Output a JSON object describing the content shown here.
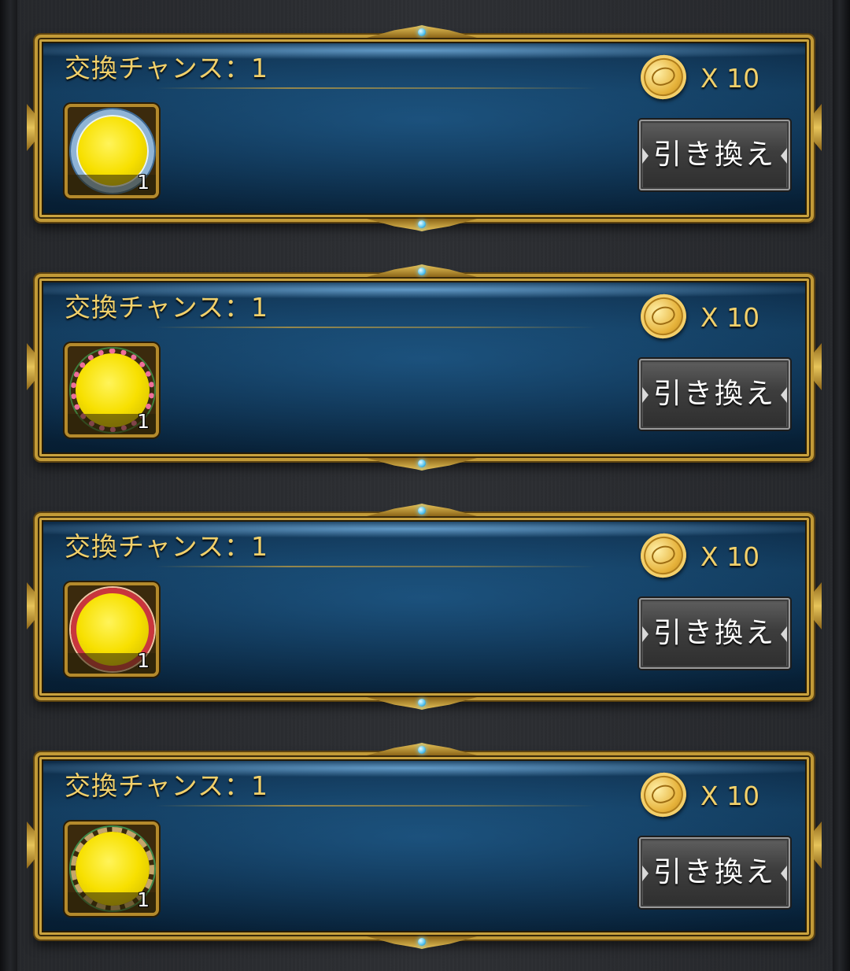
{
  "exchange_items": [
    {
      "title": "交換チャンス：1",
      "item_icon": "ice-frame-icon",
      "item_count": "1",
      "cost_icon": "gold-coin-icon",
      "cost": "X 10",
      "button_label": "引き換え"
    },
    {
      "title": "交換チャンス：1",
      "item_icon": "rose-frame-icon",
      "item_count": "1",
      "cost_icon": "gold-coin-icon",
      "cost": "X 10",
      "button_label": "引き換え"
    },
    {
      "title": "交換チャンス：1",
      "item_icon": "ribbon-frame-icon",
      "item_count": "1",
      "cost_icon": "gold-coin-icon",
      "cost": "X 10",
      "button_label": "引き換え"
    },
    {
      "title": "交換チャンス：1",
      "item_icon": "rope-frame-icon",
      "item_count": "1",
      "cost_icon": "gold-coin-icon",
      "cost": "X 10",
      "button_label": "引き換え"
    }
  ],
  "colors": {
    "gold_text": "#f1d06b",
    "panel_blue": "#0f3453",
    "gold_border": "#c29a37",
    "button_gray": "#3d3d3d",
    "item_yellow": "#f7e000"
  }
}
